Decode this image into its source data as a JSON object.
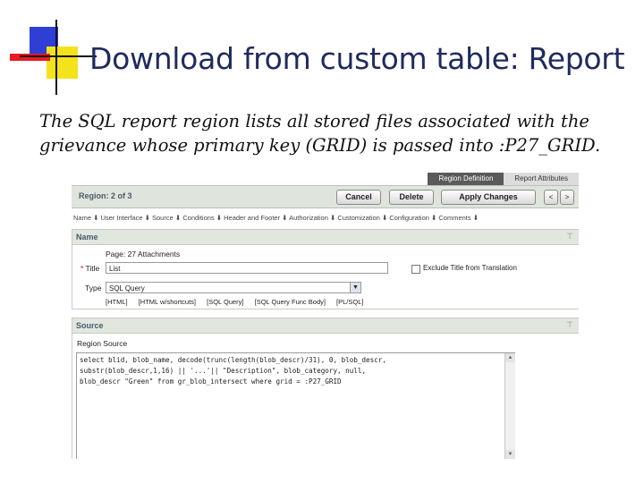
{
  "slide": {
    "title": "Download from custom table: Report",
    "caption": "The SQL report region lists all stored files associated with the grievance whose primary key (GRID) is passed into :P27_GRID."
  },
  "colors": {
    "title": "#1f2a5e",
    "deco_blue": "#2f3fd6",
    "deco_yellow": "#f4e21c",
    "deco_red": "#e81c24",
    "accent_header": "#e1e7df"
  },
  "screenshot": {
    "tabs": [
      {
        "label": "Region Definition",
        "active": true
      },
      {
        "label": "Report Attributes",
        "active": false
      }
    ],
    "region_label": "Region: 2 of 3",
    "buttons": {
      "cancel": "Cancel",
      "delete": "Delete",
      "apply": "Apply Changes",
      "prev": "<",
      "next": ">"
    },
    "section_links": "Name ⬇ User Interface ⬇ Source ⬇ Conditions ⬇ Header and Footer ⬇ Authorization ⬇ Customization ⬇ Configuration ⬇ Comments ⬇",
    "name_section": {
      "heading": "Name",
      "page_label": "Page: 27 Attachments",
      "title_label": "Title",
      "title_value": "List",
      "exclude_label": "Exclude Title from Translation",
      "type_label": "Type",
      "type_value": "SQL Query",
      "type_links": [
        "[HTML]",
        "[HTML w/shortcuts]",
        "[SQL Query]",
        "[SQL Query Func Body]",
        "[PL/SQL]"
      ]
    },
    "source_section": {
      "heading": "Source",
      "region_source_label": "Region Source",
      "sql_lines": [
        "select blid, blob_name, decode(trunc(length(blob_descr)/31), 0, blob_descr,",
        "substr(blob_descr,1,16) || '...'|| \"Description\", blob_category, null,",
        "blob_descr \"Green\" from gr_blob_intersect where grid = :P27_GRID"
      ]
    }
  }
}
